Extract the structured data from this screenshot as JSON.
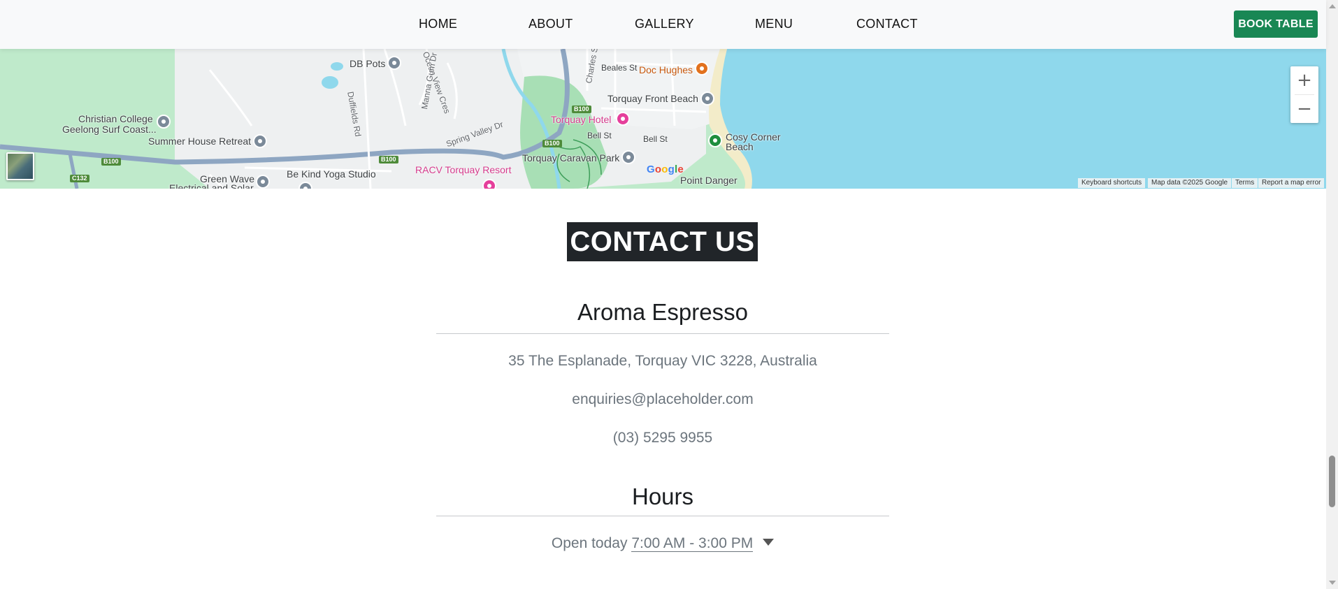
{
  "nav": {
    "links": [
      "HOME",
      "ABOUT",
      "GALLERY",
      "MENU",
      "CONTACT"
    ],
    "book_label": "BOOK TABLE",
    "book_color": "#198754"
  },
  "map": {
    "labels": {
      "db_pots": "DB Pots",
      "doc_hughes": "Doc Hughes",
      "beales_st": "Beales St",
      "torquay_front_beach": "Torquay Front Beach",
      "christian_college": "Christian College",
      "geelong_surf_coast": "Geelong Surf Coast...",
      "summer_house": "Summer House Retreat",
      "torquay_hotel": "Torquay Hotel",
      "bell_st_1": "Bell St",
      "bell_st_2": "Bell St",
      "cosy_corner": "Cosy Corner",
      "beach": "Beach",
      "torquay_caravan": "Torquay Caravan Park",
      "racv": "RACV Torquay Resort",
      "be_kind_yoga": "Be Kind Yoga Studio",
      "green_wave": "Green Wave",
      "green_wave_2": "Electrical and Solar",
      "point_danger": "Point Danger",
      "duffields_rd": "Duffields Rd",
      "spring_valley": "Spring Valley Dr",
      "ocean_view": "Ocean View Cres",
      "manna_gum": "Manna Gum Dr",
      "charles_st": "Charles St"
    },
    "shields": {
      "b100_a": "B100",
      "b100_b": "B100",
      "b100_c": "B100",
      "b100_d": "B100",
      "c132": "C132"
    },
    "google": "Google",
    "zoom_in": "+",
    "zoom_out": "−",
    "attribution": {
      "shortcuts": "Keyboard shortcuts",
      "map_data": "Map data ©2025 Google",
      "terms": "Terms",
      "report": "Report a map error"
    },
    "colors": {
      "water": "#8fd8ec",
      "land": "#bfeacb",
      "urban": "#f1f3f4",
      "highway": "#8ea6c2"
    }
  },
  "contact": {
    "heading": "CONTACT US",
    "business_name": "Aroma Espresso",
    "address": "35 The Esplanade, Torquay VIC 3228, Australia",
    "email": "enquiries@placeholder.com",
    "phone": "(03) 5295 9955",
    "hours_heading": "Hours",
    "hours_prefix": "Open today",
    "hours_value": "7:00 AM - 3:00 PM"
  }
}
